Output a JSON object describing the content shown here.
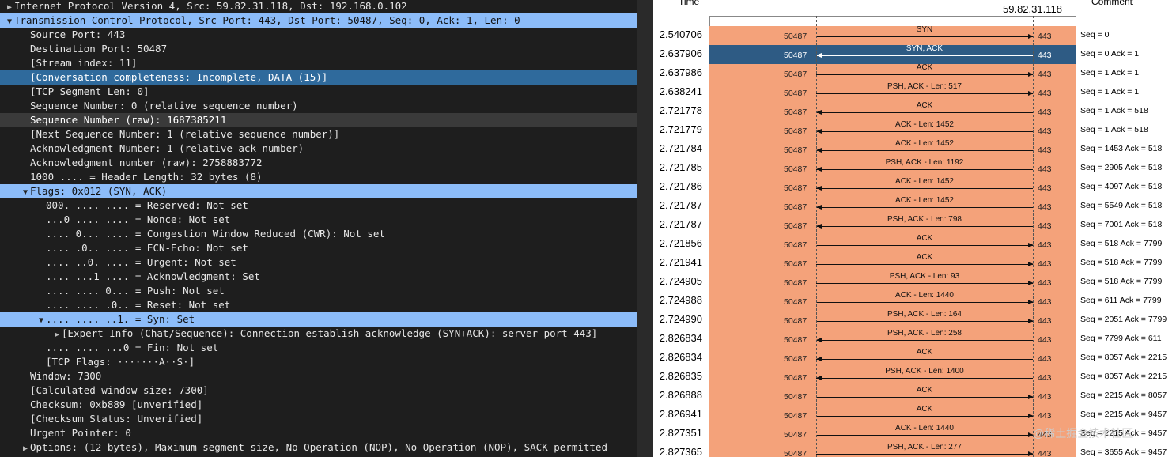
{
  "tree": {
    "rows": [
      {
        "indent": 0,
        "arrow": "▶",
        "text": "Internet Protocol Version 4, Src: 59.82.31.118, Dst: 192.168.0.102",
        "state": ""
      },
      {
        "indent": 0,
        "arrow": "▼",
        "text": "Transmission Control Protocol, Src Port: 443, Dst Port: 50487, Seq: 0, Ack: 1, Len: 0",
        "state": "sel"
      },
      {
        "indent": 1,
        "arrow": "",
        "text": "Source Port: 443",
        "state": ""
      },
      {
        "indent": 1,
        "arrow": "",
        "text": "Destination Port: 50487",
        "state": ""
      },
      {
        "indent": 1,
        "arrow": "",
        "text": "[Stream index: 11]",
        "state": ""
      },
      {
        "indent": 1,
        "arrow": "",
        "text": "[Conversation completeness: Incomplete, DATA (15)]",
        "state": "sel-dark"
      },
      {
        "indent": 1,
        "arrow": "",
        "text": "[TCP Segment Len: 0]",
        "state": ""
      },
      {
        "indent": 1,
        "arrow": "",
        "text": "Sequence Number: 0    (relative sequence number)",
        "state": ""
      },
      {
        "indent": 1,
        "arrow": "",
        "text": "Sequence Number (raw): 1687385211",
        "state": "hl"
      },
      {
        "indent": 1,
        "arrow": "",
        "text": "[Next Sequence Number: 1    (relative sequence number)]",
        "state": ""
      },
      {
        "indent": 1,
        "arrow": "",
        "text": "Acknowledgment Number: 1    (relative ack number)",
        "state": ""
      },
      {
        "indent": 1,
        "arrow": "",
        "text": "Acknowledgment number (raw): 2758883772",
        "state": ""
      },
      {
        "indent": 1,
        "arrow": "",
        "text": "1000 .... = Header Length: 32 bytes (8)",
        "state": ""
      },
      {
        "indent": 1,
        "arrow": "▼",
        "text": "Flags: 0x012 (SYN, ACK)",
        "state": "sel"
      },
      {
        "indent": 2,
        "arrow": "",
        "text": "000. .... .... = Reserved: Not set",
        "state": ""
      },
      {
        "indent": 2,
        "arrow": "",
        "text": "...0 .... .... = Nonce: Not set",
        "state": ""
      },
      {
        "indent": 2,
        "arrow": "",
        "text": ".... 0... .... = Congestion Window Reduced (CWR): Not set",
        "state": ""
      },
      {
        "indent": 2,
        "arrow": "",
        "text": ".... .0.. .... = ECN-Echo: Not set",
        "state": ""
      },
      {
        "indent": 2,
        "arrow": "",
        "text": ".... ..0. .... = Urgent: Not set",
        "state": ""
      },
      {
        "indent": 2,
        "arrow": "",
        "text": ".... ...1 .... = Acknowledgment: Set",
        "state": ""
      },
      {
        "indent": 2,
        "arrow": "",
        "text": ".... .... 0... = Push: Not set",
        "state": ""
      },
      {
        "indent": 2,
        "arrow": "",
        "text": ".... .... .0.. = Reset: Not set",
        "state": ""
      },
      {
        "indent": 2,
        "arrow": "▼",
        "text": ".... .... ..1. = Syn: Set",
        "state": "sel"
      },
      {
        "indent": 3,
        "arrow": "▶",
        "text": "[Expert Info (Chat/Sequence): Connection establish acknowledge (SYN+ACK): server port 443]",
        "state": ""
      },
      {
        "indent": 2,
        "arrow": "",
        "text": ".... .... ...0 = Fin: Not set",
        "state": ""
      },
      {
        "indent": 2,
        "arrow": "",
        "text": "[TCP Flags: ·······A··S·]",
        "state": ""
      },
      {
        "indent": 1,
        "arrow": "",
        "text": "Window: 7300",
        "state": ""
      },
      {
        "indent": 1,
        "arrow": "",
        "text": "[Calculated window size: 7300]",
        "state": ""
      },
      {
        "indent": 1,
        "arrow": "",
        "text": "Checksum: 0xb889 [unverified]",
        "state": ""
      },
      {
        "indent": 1,
        "arrow": "",
        "text": "[Checksum Status: Unverified]",
        "state": ""
      },
      {
        "indent": 1,
        "arrow": "",
        "text": "Urgent Pointer: 0",
        "state": ""
      },
      {
        "indent": 1,
        "arrow": "▶",
        "text": "Options: (12 bytes), Maximum segment size, No-Operation (NOP), No-Operation (NOP), SACK permitted",
        "state": ""
      }
    ]
  },
  "flow": {
    "header_time": "Time",
    "header_host": "59.82.31.118",
    "header_comment": "Comment",
    "rows": [
      {
        "time": "2.540706",
        "src": "50487",
        "dst": "443",
        "label": "SYN",
        "dir": "right",
        "comment": "Seq = 0",
        "sel": false
      },
      {
        "time": "2.637906",
        "src": "50487",
        "dst": "443",
        "label": "SYN, ACK",
        "dir": "left",
        "comment": "Seq = 0 Ack = 1",
        "sel": true
      },
      {
        "time": "2.637986",
        "src": "50487",
        "dst": "443",
        "label": "ACK",
        "dir": "right",
        "comment": "Seq = 1 Ack = 1",
        "sel": false
      },
      {
        "time": "2.638241",
        "src": "50487",
        "dst": "443",
        "label": "PSH, ACK - Len: 517",
        "dir": "right",
        "comment": "Seq = 1 Ack = 1",
        "sel": false
      },
      {
        "time": "2.721778",
        "src": "50487",
        "dst": "443",
        "label": "ACK",
        "dir": "left",
        "comment": "Seq = 1 Ack = 518",
        "sel": false
      },
      {
        "time": "2.721779",
        "src": "50487",
        "dst": "443",
        "label": "ACK - Len: 1452",
        "dir": "left",
        "comment": "Seq = 1 Ack = 518",
        "sel": false
      },
      {
        "time": "2.721784",
        "src": "50487",
        "dst": "443",
        "label": "ACK - Len: 1452",
        "dir": "left",
        "comment": "Seq = 1453 Ack = 518",
        "sel": false
      },
      {
        "time": "2.721785",
        "src": "50487",
        "dst": "443",
        "label": "PSH, ACK - Len: 1192",
        "dir": "left",
        "comment": "Seq = 2905 Ack = 518",
        "sel": false
      },
      {
        "time": "2.721786",
        "src": "50487",
        "dst": "443",
        "label": "ACK - Len: 1452",
        "dir": "left",
        "comment": "Seq = 4097 Ack = 518",
        "sel": false
      },
      {
        "time": "2.721787",
        "src": "50487",
        "dst": "443",
        "label": "ACK - Len: 1452",
        "dir": "left",
        "comment": "Seq = 5549 Ack = 518",
        "sel": false
      },
      {
        "time": "2.721787",
        "src": "50487",
        "dst": "443",
        "label": "PSH, ACK - Len: 798",
        "dir": "left",
        "comment": "Seq = 7001 Ack = 518",
        "sel": false
      },
      {
        "time": "2.721856",
        "src": "50487",
        "dst": "443",
        "label": "ACK",
        "dir": "right",
        "comment": "Seq = 518 Ack = 7799",
        "sel": false
      },
      {
        "time": "2.721941",
        "src": "50487",
        "dst": "443",
        "label": "ACK",
        "dir": "right",
        "comment": "Seq = 518 Ack = 7799",
        "sel": false
      },
      {
        "time": "2.724905",
        "src": "50487",
        "dst": "443",
        "label": "PSH, ACK - Len: 93",
        "dir": "right",
        "comment": "Seq = 518 Ack = 7799",
        "sel": false
      },
      {
        "time": "2.724988",
        "src": "50487",
        "dst": "443",
        "label": "ACK - Len: 1440",
        "dir": "right",
        "comment": "Seq = 611 Ack = 7799",
        "sel": false
      },
      {
        "time": "2.724990",
        "src": "50487",
        "dst": "443",
        "label": "PSH, ACK - Len: 164",
        "dir": "right",
        "comment": "Seq = 2051 Ack = 7799",
        "sel": false
      },
      {
        "time": "2.826834",
        "src": "50487",
        "dst": "443",
        "label": "PSH, ACK - Len: 258",
        "dir": "left",
        "comment": "Seq = 7799 Ack = 611",
        "sel": false
      },
      {
        "time": "2.826834",
        "src": "50487",
        "dst": "443",
        "label": "ACK",
        "dir": "left",
        "comment": "Seq = 8057 Ack = 2215",
        "sel": false
      },
      {
        "time": "2.826835",
        "src": "50487",
        "dst": "443",
        "label": "PSH, ACK - Len: 1400",
        "dir": "left",
        "comment": "Seq = 8057 Ack = 2215",
        "sel": false
      },
      {
        "time": "2.826888",
        "src": "50487",
        "dst": "443",
        "label": "ACK",
        "dir": "right",
        "comment": "Seq = 2215 Ack = 8057",
        "sel": false
      },
      {
        "time": "2.826941",
        "src": "50487",
        "dst": "443",
        "label": "ACK",
        "dir": "right",
        "comment": "Seq = 2215 Ack = 9457",
        "sel": false
      },
      {
        "time": "2.827351",
        "src": "50487",
        "dst": "443",
        "label": "ACK - Len: 1440",
        "dir": "right",
        "comment": "Seq = 2215 Ack = 9457",
        "sel": false
      },
      {
        "time": "2.827365",
        "src": "50487",
        "dst": "443",
        "label": "PSH, ACK - Len: 277",
        "dir": "right",
        "comment": "Seq = 3655 Ack = 9457",
        "sel": false
      }
    ]
  },
  "watermark": "@稀土掘金技术社区"
}
